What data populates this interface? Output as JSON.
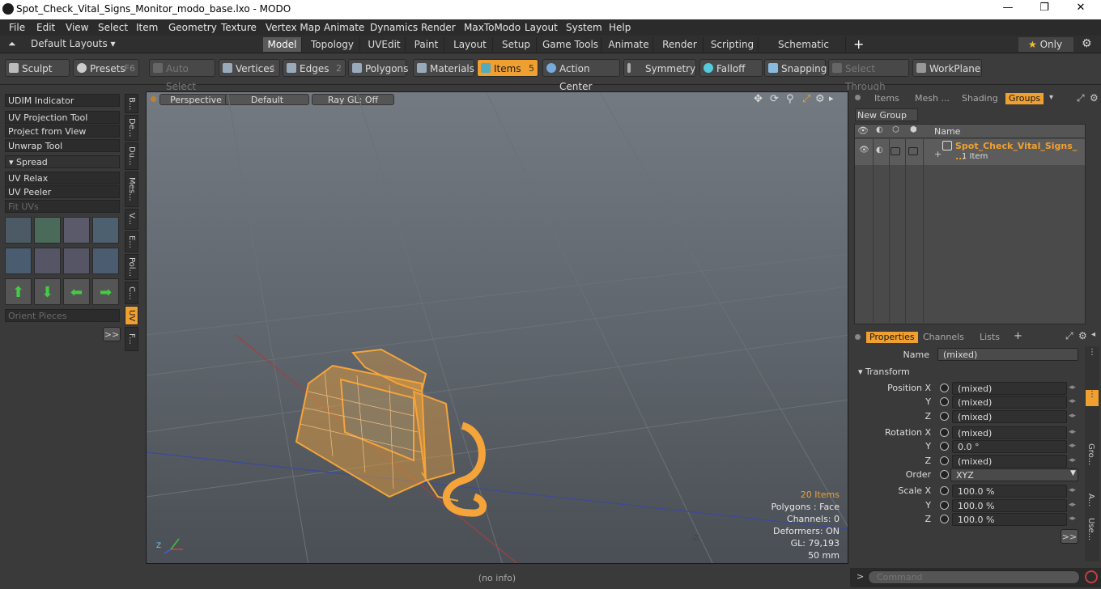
{
  "window": {
    "title": "Spot_Check_Vital_Signs_Monitor_modo_base.lxo - MODO"
  },
  "menu": [
    "File",
    "Edit",
    "View",
    "Select",
    "Item",
    "Geometry",
    "Texture",
    "Vertex Map",
    "Animate",
    "Dynamics",
    "Render",
    "MaxToModo",
    "Layout",
    "System",
    "Help"
  ],
  "layout": {
    "default_layouts": "Default Layouts ▾",
    "only": "Only"
  },
  "layout_tabs": [
    "Model",
    "Topology",
    "UVEdit",
    "Paint",
    "Layout",
    "Setup",
    "Game Tools",
    "Animate",
    "Render",
    "Scripting",
    "Schematic Fusion"
  ],
  "toolbar": {
    "sculpt": "Sculpt",
    "presets": "Presets",
    "presets_key": "F6",
    "auto_select": "Auto Select",
    "vertices": "Vertices",
    "vertices_key": "1",
    "edges": "Edges",
    "edges_key": "2",
    "polygons": "Polygons",
    "materials": "Materials",
    "items": "Items",
    "items_key": "5",
    "action_center": "Action Center",
    "symmetry": "Symmetry",
    "falloff": "Falloff",
    "snapping": "Snapping",
    "select_through": "Select Through",
    "workplane": "WorkPlane"
  },
  "left_panel": {
    "buttons": [
      "UDIM Indicator",
      "UV Projection Tool",
      "Project from View",
      "Unwrap Tool"
    ],
    "spread": "Spread",
    "buttons2": [
      "UV Relax",
      "UV Peeler",
      "Fit UVs"
    ],
    "orient": "Orient Pieces",
    "more": ">>",
    "vtabs": [
      "B...",
      "De...",
      "Du...",
      "Mes...",
      "V...",
      "E...",
      "Pol...",
      "C...",
      "UV",
      "F..."
    ]
  },
  "viewport": {
    "perspective": "Perspective",
    "default": "Default",
    "raygl": "Ray GL: Off",
    "stats": {
      "items": "20 Items",
      "polygons": "Polygons : Face",
      "channels": "Channels: 0",
      "deformers": "Deformers: ON",
      "gl": "GL: 79,193",
      "mm": "50 mm"
    },
    "axis_label": "-Z"
  },
  "status": "(no info)",
  "items_panel": {
    "tabs": [
      "Items",
      "Mesh ...",
      "Shading",
      "Groups"
    ],
    "new_group": "New Group",
    "name_col": "Name",
    "group_name": "Spot_Check_Vital_Signs_ ...",
    "group_count": "1 Item"
  },
  "properties": {
    "tabs": [
      "Properties",
      "Channels",
      "Lists"
    ],
    "name_label": "Name",
    "name_value": "(mixed)",
    "transform": "Transform",
    "rows": [
      {
        "label": "Position X",
        "value": "(mixed)"
      },
      {
        "label": "Y",
        "value": "(mixed)"
      },
      {
        "label": "Z",
        "value": "(mixed)"
      },
      {
        "label": "Rotation X",
        "value": "(mixed)"
      },
      {
        "label": "Y",
        "value": "0.0 °"
      },
      {
        "label": "Z",
        "value": "(mixed)"
      },
      {
        "label": "Order",
        "value": "XYZ"
      },
      {
        "label": "Scale X",
        "value": "100.0 %"
      },
      {
        "label": "Y",
        "value": "100.0 %"
      },
      {
        "label": "Z",
        "value": "100.0 %"
      }
    ],
    "more": ">>",
    "side_tabs": [
      "Gro...",
      "A...",
      "Use..."
    ]
  },
  "command": {
    "prompt": ">",
    "placeholder": "Command"
  },
  "colors": {
    "accent": "#f0a030",
    "wire": "#f5a43a"
  }
}
